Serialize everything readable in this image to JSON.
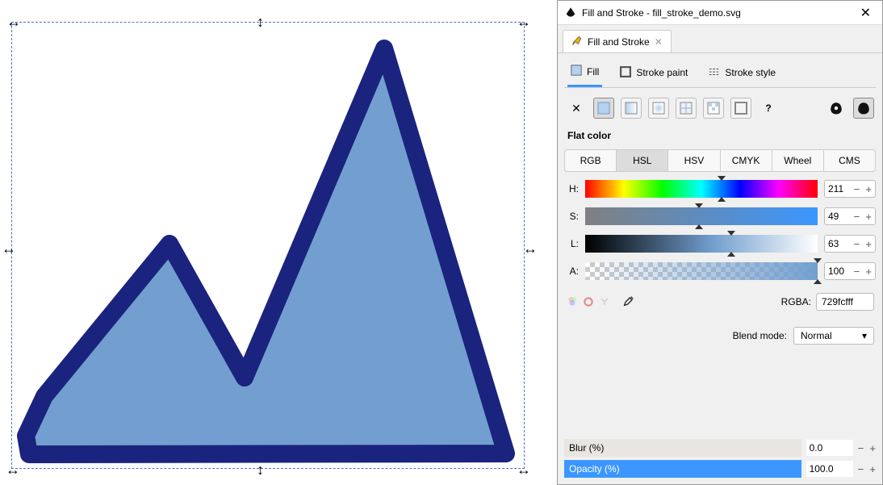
{
  "window": {
    "title": "Fill and Stroke - fill_stroke_demo.svg"
  },
  "dock_tab": {
    "label": "Fill and Stroke"
  },
  "sub_tabs": {
    "fill": "Fill",
    "stroke_paint": "Stroke paint",
    "stroke_style": "Stroke style"
  },
  "section": {
    "flat_color": "Flat color"
  },
  "color_models": {
    "rgb": "RGB",
    "hsl": "HSL",
    "hsv": "HSV",
    "cmyk": "CMYK",
    "wheel": "Wheel",
    "cms": "CMS"
  },
  "hsl": {
    "h_label": "H:",
    "h_value": "211",
    "s_label": "S:",
    "s_value": "49",
    "l_label": "L:",
    "l_value": "63",
    "a_label": "A:",
    "a_value": "100"
  },
  "rgba": {
    "label": "RGBA:",
    "value": "729fcfff"
  },
  "blend": {
    "label": "Blend mode:",
    "value": "Normal"
  },
  "blur": {
    "label": "Blur (%)",
    "value": "0.0"
  },
  "opacity": {
    "label": "Opacity (%)",
    "value": "100.0"
  },
  "colors": {
    "shape_fill": "#729fcf",
    "shape_stroke": "#1a237e",
    "accent": "#3b97ff"
  },
  "icon_names": {
    "flat": "flat-color-swatch",
    "lingrad": "linear-gradient-swatch",
    "radgrad": "radial-gradient-swatch",
    "pattern": "pattern-swatch",
    "mesh": "mesh-swatch",
    "swatch": "swatch-icon",
    "unknown": "unknown-paint",
    "inherit": "inherit-paint",
    "spiral-paint": "spiral-paint-icon"
  }
}
